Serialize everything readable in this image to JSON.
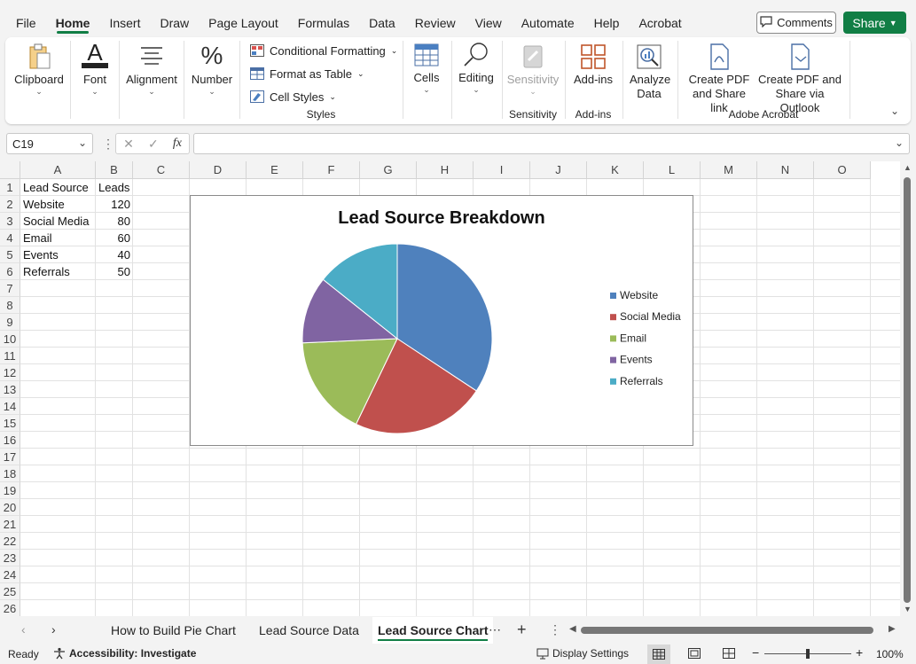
{
  "menu": [
    "File",
    "Home",
    "Insert",
    "Draw",
    "Page Layout",
    "Formulas",
    "Data",
    "Review",
    "View",
    "Automate",
    "Help",
    "Acrobat"
  ],
  "active_menu": "Home",
  "comments_label": "Comments",
  "share_label": "Share",
  "ribbon": {
    "clipboard": "Clipboard",
    "font": "Font",
    "alignment": "Alignment",
    "number": "Number",
    "conditional_formatting": "Conditional Formatting",
    "format_as_table": "Format as Table",
    "cell_styles": "Cell Styles",
    "styles_group": "Styles",
    "cells": "Cells",
    "editing": "Editing",
    "sensitivity_btn": "Sensitivity",
    "sensitivity_group": "Sensitivity",
    "addins_btn": "Add-ins",
    "addins_group": "Add-ins",
    "analyze_data": "Analyze Data",
    "create_pdf_share_link": "Create PDF and Share link",
    "create_pdf_outlook": "Create PDF and Share via Outlook",
    "acrobat_group": "Adobe Acrobat"
  },
  "name_box": "C19",
  "fx_label": "fx",
  "columns": [
    "A",
    "B",
    "C",
    "D",
    "E",
    "F",
    "G",
    "H",
    "I",
    "J",
    "K",
    "L",
    "M",
    "N",
    "O"
  ],
  "rows": [
    "1",
    "2",
    "3",
    "4",
    "5",
    "6",
    "7",
    "8",
    "9",
    "10",
    "11",
    "12",
    "13",
    "14",
    "15",
    "16",
    "17",
    "18",
    "19",
    "20",
    "21",
    "22",
    "23",
    "24",
    "25",
    "26"
  ],
  "cells": {
    "A1": "Lead Source",
    "B1": "Leads",
    "A2": "Website",
    "B2": "120",
    "A3": "Social Media",
    "B3": "80",
    "A4": "Email",
    "B4": "60",
    "A5": "Events",
    "B5": "40",
    "A6": "Referrals",
    "B6": "50"
  },
  "chart_data": {
    "type": "pie",
    "title": "Lead Source Breakdown",
    "categories": [
      "Website",
      "Social Media",
      "Email",
      "Events",
      "Referrals"
    ],
    "values": [
      120,
      80,
      60,
      40,
      50
    ],
    "colors": [
      "#4f81bd",
      "#c0504d",
      "#9bbb59",
      "#8064a2",
      "#4bacc6"
    ],
    "legend": "right"
  },
  "sheet_tabs": [
    "How to Build Pie Chart",
    "Lead Source Data",
    "Lead Source Chart"
  ],
  "active_sheet": "Lead Source Chart",
  "status": {
    "ready": "Ready",
    "accessibility": "Accessibility: Investigate",
    "display_settings": "Display Settings",
    "zoom": "100%"
  }
}
